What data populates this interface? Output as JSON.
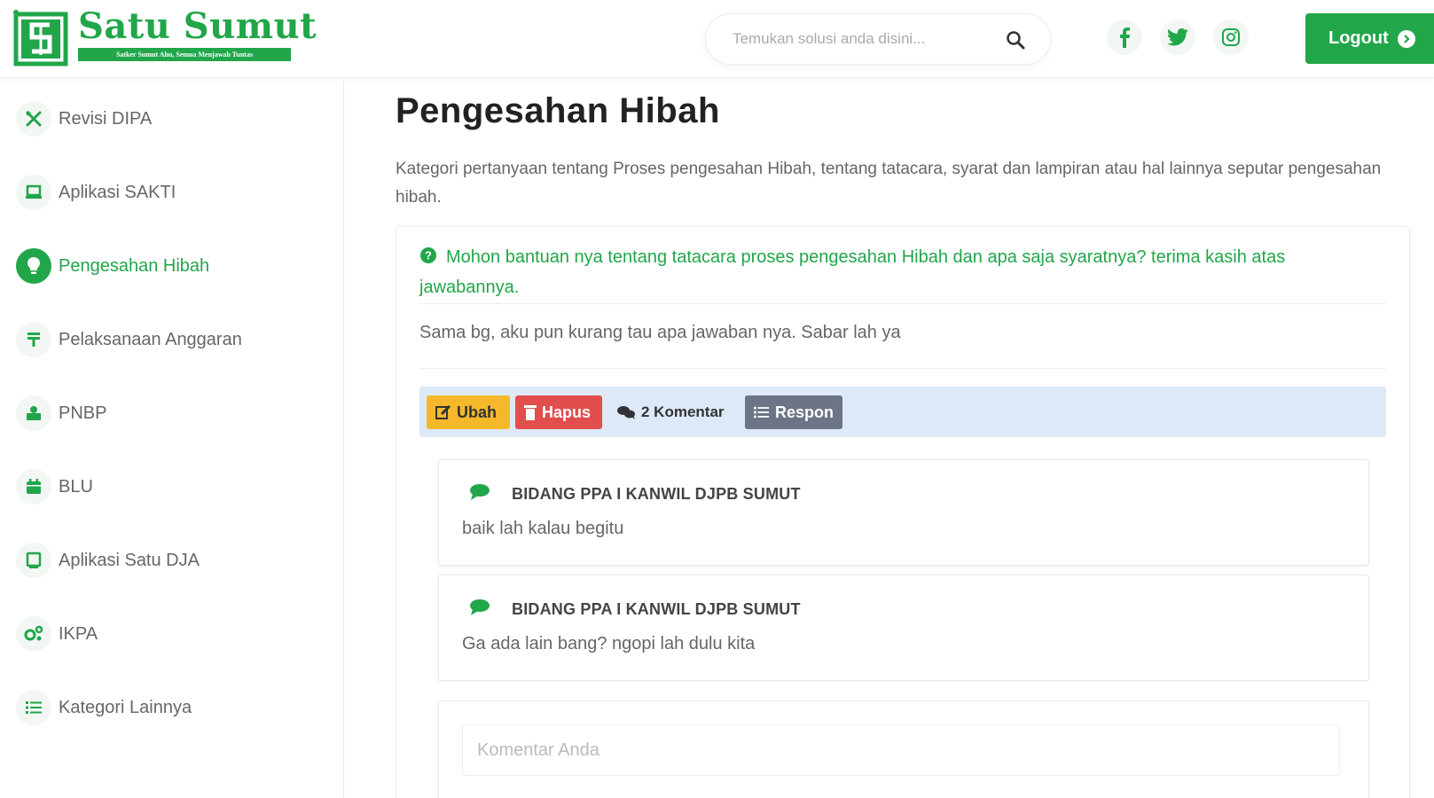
{
  "header": {
    "logo_title": "Satu Sumut",
    "logo_tagline": "Satker Sumut Ahu, Semua Menjawab Tuntas",
    "search_placeholder": "Temukan solusi anda disini...",
    "logout_label": "Logout",
    "social": [
      "facebook-icon",
      "twitter-icon",
      "instagram-icon"
    ]
  },
  "colors": {
    "brand_green": "#21a64a",
    "edit_yellow": "#f5b82a",
    "delete_red": "#e24d4d",
    "respon_gray": "#6c7486",
    "actionbar_blue": "#dde9f7"
  },
  "sidebar": {
    "items": [
      {
        "label": "Revisi DIPA",
        "icon": "tools-icon",
        "active": false
      },
      {
        "label": "Aplikasi SAKTI",
        "icon": "laptop-icon",
        "active": false
      },
      {
        "label": "Pengesahan Hibah",
        "icon": "lightbulb-icon",
        "active": true
      },
      {
        "label": "Pelaksanaan Anggaran",
        "icon": "money-icon",
        "active": false
      },
      {
        "label": "PNBP",
        "icon": "coins-icon",
        "active": false
      },
      {
        "label": "BLU",
        "icon": "calendar-icon",
        "active": false
      },
      {
        "label": "Aplikasi Satu DJA",
        "icon": "monitor-icon",
        "active": false
      },
      {
        "label": "IKPA",
        "icon": "gears-icon",
        "active": false
      },
      {
        "label": "Kategori Lainnya",
        "icon": "list-icon",
        "active": false
      }
    ]
  },
  "main": {
    "title": "Pengesahan Hibah",
    "description": "Kategori pertanyaan tentang Proses pengesahan Hibah, tentang tatacara, syarat dan lampiran atau hal lainnya seputar pengesahan hibah.",
    "question": "Mohon bantuan nya tentang tatacara proses pengesahan Hibah dan apa saja syaratnya? terima kasih atas jawabannya.",
    "answer": "Sama bg, aku pun kurang tau apa jawaban nya. Sabar lah ya",
    "actions": {
      "edit_label": "Ubah",
      "delete_label": "Hapus",
      "comments_label": "2 Komentar",
      "respond_label": "Respon"
    },
    "comments": [
      {
        "author": "BIDANG PPA I KANWIL DJPB SUMUT",
        "text": "baik lah kalau begitu"
      },
      {
        "author": "BIDANG PPA I KANWIL DJPB SUMUT",
        "text": "Ga ada lain bang? ngopi lah dulu kita"
      }
    ],
    "comment_placeholder": "Komentar Anda"
  }
}
